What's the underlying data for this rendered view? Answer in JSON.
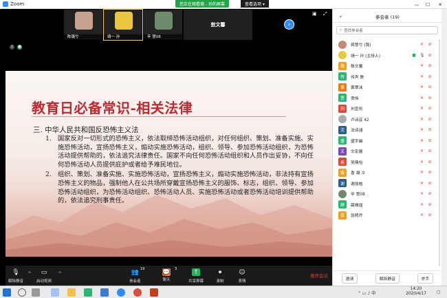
{
  "window": {
    "title": "Zoom",
    "min": "—",
    "max": "☐",
    "close": "✕"
  },
  "banners": {
    "sharing": "您正在观看德 - 孙的屏幕",
    "view_options": "查看选项 ▾"
  },
  "thumbs": [
    {
      "name": "陈璐兮",
      "color": "#c8a28e"
    },
    {
      "name": "靖一 孙",
      "color": "#e9c63c"
    },
    {
      "name": "辛 慧08",
      "color": "#6d8b6a"
    },
    {
      "name": "敖文馨",
      "color": ""
    }
  ],
  "slide": {
    "title": "教育日必备常识-相关法律",
    "section": "三. 中华人民共和国反恐怖主义法",
    "items": [
      {
        "num": "1.",
        "text": "国家反对一切形式的恐怖主义，依法取缔恐怖活动组织，对任何组织、策划、准备实施、实施恐怖活动，宣扬恐怖主义，煽动实施恐怖活动，组织、领导、参加恐怖活动组织，为恐怖活动提供帮助的，依法追究法律责任。国家不向任何恐怖活动组织和人员作出妥协，不向任何恐怖活动人员提供庇护或者给予难民地位。"
      },
      {
        "num": "2.",
        "text": "组织、策划、准备实施、实施恐怖活动，宣扬恐怖主义，煽动实施恐怖活动，非法持有宣扬恐怖主义的物品，强制他人在公共场所穿戴宣扬恐怖主义的服饰、标志，组织、领导、参加恐怖活动组织，为恐怖活动组织、恐怖活动人员、实施恐怖活动或者恐怖活动培训提供帮助的，依法追究刑事责任。"
      }
    ]
  },
  "toolbar": {
    "unmute": "解除静音",
    "start_video": "启动视频",
    "participants": "参会者",
    "participants_count": "19",
    "chat": "聊天",
    "chat_badge": "3",
    "share": "共享屏幕",
    "record": "录制",
    "reactions": "表情",
    "end": "离开会议"
  },
  "panel": {
    "title": "参会者 (19)",
    "search_placeholder": "查找参会者",
    "participants": [
      {
        "name": "蒋慧兮 (我)",
        "avatar": "",
        "color": "#c68a72",
        "photo": true
      },
      {
        "name": "靖一 孙 (主持人)",
        "avatar": "",
        "color": "#e9c63c",
        "photo": true,
        "host": true
      },
      {
        "name": "敖文馨",
        "avatar": "敖",
        "color": "#f0a020"
      },
      {
        "name": "传声 教",
        "avatar": "传",
        "color": "#2bb673"
      },
      {
        "name": "黄翠沫",
        "avatar": "黄",
        "color": "#f07b12"
      },
      {
        "name": "贾恒",
        "avatar": "贾",
        "color": "#2bb673"
      },
      {
        "name": "刘宜彤",
        "avatar": "刘",
        "color": "#e0483a"
      },
      {
        "name": "卢诗芸 42",
        "avatar": "",
        "color": "#aaa",
        "photo": true
      },
      {
        "name": "沈诗涵",
        "avatar": "沈",
        "color": "#2a5e8c"
      },
      {
        "name": "盛宇晨",
        "avatar": "盛",
        "color": "#2bb673"
      },
      {
        "name": "文宏展",
        "avatar": "文",
        "color": "#7a45b8"
      },
      {
        "name": "吴倩怡",
        "avatar": "吴",
        "color": "#e0483a"
      },
      {
        "name": "香 凝 冷",
        "avatar": "香",
        "color": "#f0a020"
      },
      {
        "name": "谢丽皓",
        "avatar": "谢",
        "color": "#2a5e8c"
      },
      {
        "name": "辛 慧08",
        "avatar": "",
        "color": "#6d8b6a",
        "photo": true
      },
      {
        "name": "薛晴瑶",
        "avatar": "薛",
        "color": "#2bb673"
      },
      {
        "name": "张熙乔",
        "avatar": "张",
        "color": "#f0a020"
      }
    ],
    "footer": {
      "invite": "邀请",
      "mute_all": "解除静音",
      "raise_hand": "举手"
    }
  },
  "taskbar": {
    "time": "14:20",
    "date": "2020/4/17"
  }
}
